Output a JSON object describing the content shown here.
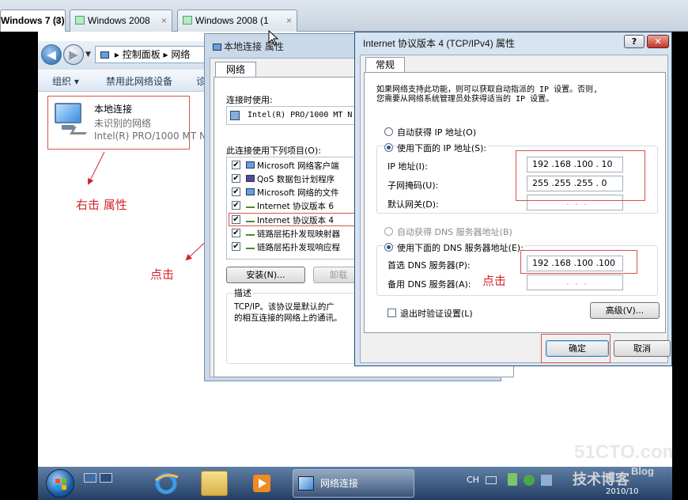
{
  "host_tabs": [
    {
      "label": "Windows 7 (3)",
      "close": "×"
    },
    {
      "label": "Windows 2008",
      "close": "×"
    },
    {
      "label": "Windows 2008 (1",
      "close": "×"
    }
  ],
  "explorer": {
    "back": "◀",
    "forward": "▶",
    "breadcrumb_sep": "▸",
    "breadcrumb": [
      "控制面板",
      "网络"
    ],
    "commands": [
      "组织 ▾",
      "禁用此网络设备",
      "诊"
    ],
    "connection": {
      "name": "本地连接",
      "status": "未识别的网络",
      "adapter": "Intel(R) PRO/1000 MT N"
    }
  },
  "dialog_props": {
    "title": "本地连接 属性",
    "tab": "网络",
    "connect_using_label": "连接时使用:",
    "adapter": "Intel(R) PRO/1000 MT N",
    "items_label": "此连接使用下列项目(O):",
    "items": [
      {
        "label": "Microsoft 网络客户端",
        "checked": true,
        "icon": "network-client-icon"
      },
      {
        "label": "QoS 数据包计划程序",
        "checked": true,
        "icon": "qos-icon"
      },
      {
        "label": "Microsoft 网络的文件",
        "checked": true,
        "icon": "file-share-icon"
      },
      {
        "label": "Internet 协议版本 6",
        "checked": true,
        "icon": "protocol-icon"
      },
      {
        "label": "Internet 协议版本 4",
        "checked": true,
        "icon": "protocol-icon"
      },
      {
        "label": "链路层拓扑发现映射器",
        "checked": true,
        "icon": "protocol-icon"
      },
      {
        "label": "链路层拓扑发现响应程",
        "checked": true,
        "icon": "protocol-icon"
      }
    ],
    "install_button": "安装(N)...",
    "uninstall_button": "卸载",
    "desc_label": "描述",
    "desc_line1": "TCP/IP。该协议是默认的广",
    "desc_line2": "的相互连接的网络上的通讯。"
  },
  "dialog_ipv4": {
    "title": "Internet 协议版本 4 (TCP/IPv4) 属性",
    "help": "?",
    "close": "✕",
    "tab": "常规",
    "intro_line1": "如果网络支持此功能，则可以获取自动指派的 IP 设置。否则,",
    "intro_line2": "您需要从网络系统管理员处获得适当的 IP 设置。",
    "auto_ip_label": "自动获得 IP 地址(O)",
    "manual_ip_label": "使用下面的 IP 地址(S):",
    "ip_label": "IP 地址(I):",
    "ip_value": "192 .168 .100 . 10",
    "mask_label": "子网掩码(U):",
    "mask_value": "255 .255 .255 . 0",
    "gateway_label": "默认网关(D):",
    "gateway_value": ". . .",
    "auto_dns_label": "自动获得 DNS 服务器地址(B)",
    "manual_dns_label": "使用下面的 DNS 服务器地址(E):",
    "dns1_label": "首选 DNS 服务器(P):",
    "dns1_value": "192 .168 .100 .100",
    "dns2_label": "备用 DNS 服务器(A):",
    "dns2_value": ". . .",
    "validate_label": "退出时验证设置(L)",
    "advanced_button": "高级(V)...",
    "ok_button": "确定",
    "cancel_button": "取消"
  },
  "annotations": {
    "right_click": "右击 属性",
    "click1": "点击",
    "click2": "点击"
  },
  "taskbar": {
    "active_window": "网络连接",
    "tray_lang": "CH",
    "clock": "2010/10"
  },
  "watermark": {
    "site": "51CTO.com",
    "tagline": "技术博客",
    "blog": "Blog"
  }
}
